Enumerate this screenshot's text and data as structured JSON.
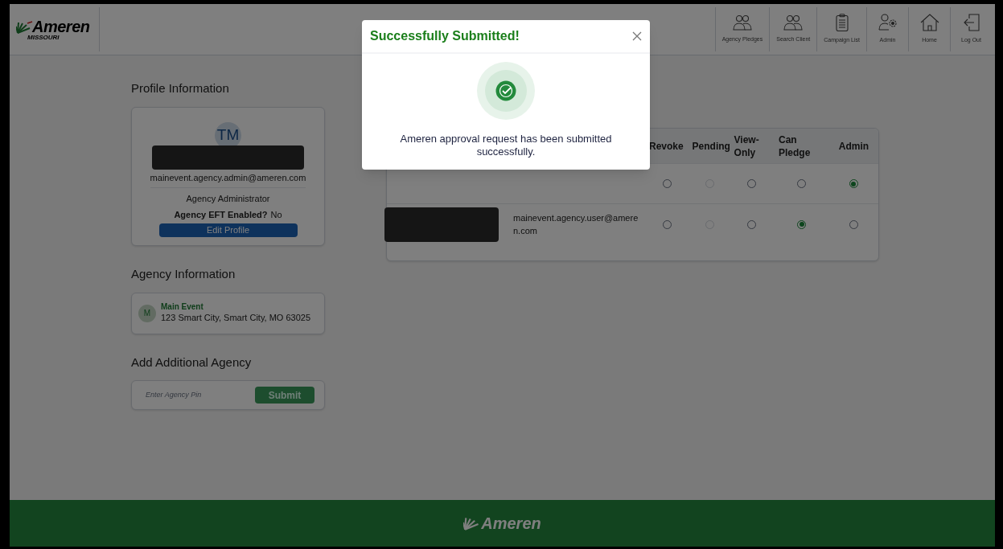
{
  "header": {
    "logo": {
      "brand": "Ameren",
      "region": "MISSOURI"
    },
    "nav": [
      {
        "label": "Agency Pledges",
        "kind": "people"
      },
      {
        "label": "Search Client",
        "kind": "people"
      },
      {
        "label": "Campaign List",
        "kind": "clipboard"
      },
      {
        "label": "Admin",
        "kind": "admin"
      },
      {
        "label": "Home",
        "kind": "home"
      },
      {
        "label": "Log Out",
        "kind": "logout"
      }
    ]
  },
  "profile": {
    "heading": "Profile Information",
    "initials": "TM",
    "name_redacted": true,
    "email": "mainevent.agency.admin@ameren.com",
    "role": "Agency Administrator",
    "eft_label": "Agency EFT Enabled?",
    "eft_value": "No",
    "edit_button": "Edit Profile"
  },
  "agency": {
    "heading": "Agency Information",
    "initial": "M",
    "name": "Main Event",
    "address": "123 Smart City, Smart City, MO 63025"
  },
  "add_agency": {
    "heading": "Add Additional Agency",
    "pin": {
      "placeholder": "Enter Agency Pin"
    },
    "submit": "Submit"
  },
  "table": {
    "columns": [
      "Revoke",
      "Pending",
      "View-Only",
      "Can Pledge",
      "Admin"
    ],
    "rows": [
      {
        "name_redacted": false,
        "options": [
          {
            "selected": false,
            "disabled": false
          },
          {
            "selected": false,
            "disabled": true
          },
          {
            "selected": false,
            "disabled": false
          },
          {
            "selected": false,
            "disabled": false
          },
          {
            "selected": true,
            "disabled": false
          }
        ]
      },
      {
        "name_redacted": true,
        "email": "mainevent.agency.user@ameren.com",
        "options": [
          {
            "selected": false,
            "disabled": false
          },
          {
            "selected": false,
            "disabled": true
          },
          {
            "selected": false,
            "disabled": false
          },
          {
            "selected": true,
            "disabled": false
          },
          {
            "selected": false,
            "disabled": false
          }
        ]
      }
    ]
  },
  "modal": {
    "title": "Successfully Submitted!",
    "message": "Ameren approval request has been submitted successfully."
  },
  "footer": {
    "brand": "Ameren"
  }
}
